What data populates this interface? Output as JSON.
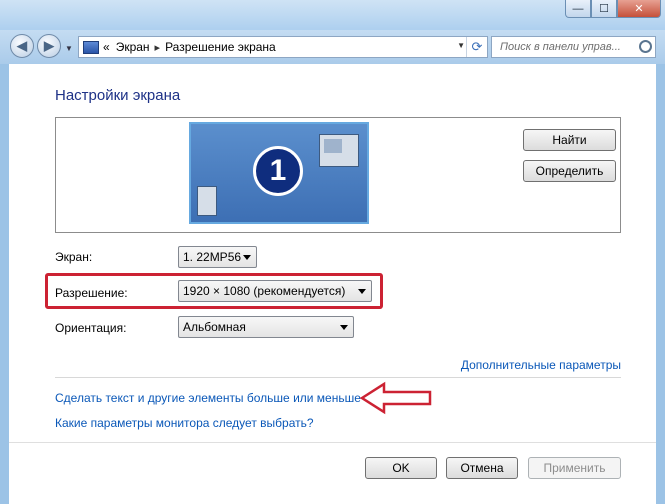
{
  "window": {
    "minimize_icon": "minimize-icon",
    "maximize_icon": "maximize-icon",
    "close_icon": "close-icon",
    "min_glyph": "—",
    "max_glyph": "☐",
    "close_glyph": "✕"
  },
  "navigation": {
    "back_glyph": "◀",
    "forward_glyph": "▶",
    "breadcrumb_prefix": "«",
    "breadcrumb": [
      "Экран",
      "Разрешение экрана"
    ],
    "breadcrumb_separator": "▸",
    "refresh_glyph": "⟳",
    "search_placeholder": "Поиск в панели управ..."
  },
  "page": {
    "title": "Настройки экрана",
    "monitor_number": "1",
    "detect_button": "Найти",
    "identify_button": "Определить",
    "fields": {
      "display_label": "Экран:",
      "display_value": "1. 22MP56",
      "resolution_label": "Разрешение:",
      "resolution_value": "1920 × 1080 (рекомендуется)",
      "orientation_label": "Ориентация:",
      "orientation_value": "Альбомная"
    },
    "advanced_link": "Дополнительные параметры",
    "text_size_link": "Сделать текст и другие элементы больше или меньше",
    "monitor_help_link": "Какие параметры монитора следует выбрать?"
  },
  "footer": {
    "ok_label": "OK",
    "cancel_label": "Отмена",
    "apply_label": "Применить"
  },
  "colors": {
    "title": "#1e3287",
    "link": "#0b58b8",
    "annotation": "#cc2233"
  }
}
